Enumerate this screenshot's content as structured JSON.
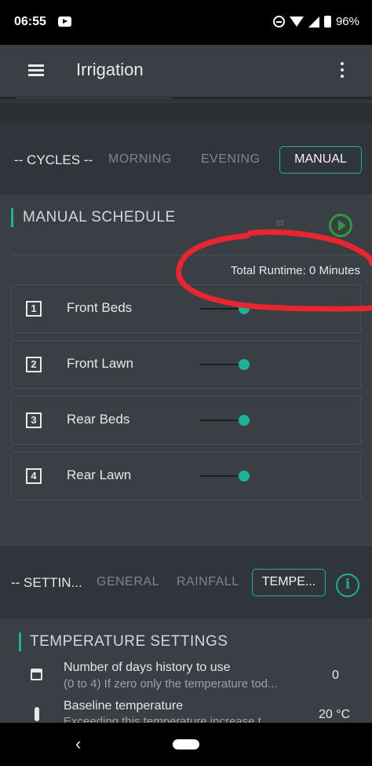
{
  "status_bar": {
    "time": "06:55",
    "battery": "96%"
  },
  "app_bar": {
    "title": "Irrigation"
  },
  "cycles": {
    "label": "-- CYCLES --",
    "tabs": [
      "MORNING",
      "EVENING",
      "MANUAL"
    ],
    "active_tab": "MANUAL"
  },
  "manual_schedule": {
    "title": "MANUAL SCHEDULE",
    "total_runtime": "Total Runtime: 0 Minutes",
    "zones": [
      {
        "number": "1",
        "label": "Front Beds",
        "level": 1
      },
      {
        "number": "2",
        "label": "Front Lawn",
        "level": 1
      },
      {
        "number": "3",
        "label": "Rear Beds",
        "level": 1
      },
      {
        "number": "4",
        "label": "Rear Lawn",
        "level": 1
      }
    ]
  },
  "settings": {
    "label": "-- SETTIN...",
    "tabs": [
      "GENERAL",
      "RAINFALL",
      "TEMPE..."
    ],
    "active_tab": "TEMPE..."
  },
  "temperature_settings": {
    "title": "TEMPERATURE SETTINGS",
    "items": [
      {
        "icon": "calendar-icon",
        "title": "Number of days history to use",
        "desc": "(0 to 4) If zero only the temperature tod...",
        "value": "0"
      },
      {
        "icon": "thermometer-icon",
        "title": "Baseline temperature",
        "desc": "Exceeding this temperature increase t...",
        "value": "20 °C"
      }
    ]
  },
  "colors": {
    "accent": "#1fb195",
    "play": "#2f9a3a",
    "annotation": "#e8262f"
  }
}
